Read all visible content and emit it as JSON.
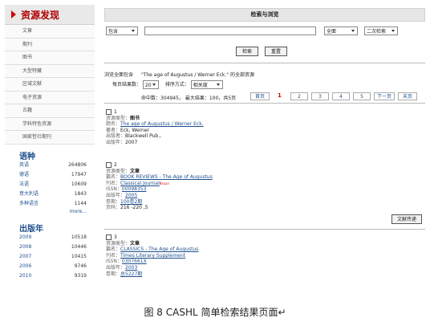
{
  "sidebar": {
    "title": "资源发现",
    "items": [
      "文章",
      "期刊",
      "图书",
      "大型特藏",
      "区域文献",
      "电子资源",
      "古籍",
      "学科特色资源",
      "国家哲社期刊"
    ],
    "languages": {
      "title": "语种",
      "rows": [
        {
          "name": "英语",
          "count": "264806"
        },
        {
          "name": "德语",
          "count": "17947"
        },
        {
          "name": "法语",
          "count": "10609"
        },
        {
          "name": "意大利语",
          "count": "1843"
        },
        {
          "name": "多种语言",
          "count": "1144"
        }
      ],
      "more": "more..."
    },
    "years": {
      "title": "出版年",
      "rows": [
        {
          "name": "2009",
          "count": "10518"
        },
        {
          "name": "2008",
          "count": "10446"
        },
        {
          "name": "2007",
          "count": "10415"
        },
        {
          "name": "2006",
          "count": "9746"
        },
        {
          "name": "2010",
          "count": "9319"
        }
      ]
    }
  },
  "search": {
    "header": "检索与浏览",
    "match_select": "包含",
    "query_value": "",
    "scope_select": "全面",
    "mode_select": "二次检索",
    "search_button": "检索",
    "reset_button": "重置"
  },
  "results": {
    "browse_prefix": "浏览全面包含",
    "browse_query": "\"The age of Augustus / Werner Eck.\"",
    "browse_suffix": "的全部资源",
    "per_page_label": "每页结果数：",
    "per_page_value": "20",
    "sort_label": "排序方式：",
    "sort_value": "相关度",
    "hits_label": "命中数：304945，",
    "max_label": "最大结果：100，共5页",
    "pager": {
      "first": "首页",
      "current": "1",
      "pages": [
        "2",
        "3",
        "4",
        "5"
      ],
      "next": "下一页",
      "last": "末页"
    },
    "records": [
      {
        "num": "1",
        "fields": [
          {
            "k": "资源类型：",
            "v": "图书",
            "link": false,
            "bold": true
          },
          {
            "k": "题名：",
            "v": "The age of Augustus / Werner Eck.",
            "link": true
          },
          {
            "k": "著者：",
            "v": "Eck, Werner",
            "link": false
          },
          {
            "k": "出版者：",
            "v": "Blackwell Pub.,",
            "link": false
          },
          {
            "k": "出版年：",
            "v": "2007",
            "link": false
          }
        ]
      },
      {
        "num": "2",
        "fields": [
          {
            "k": "资源类型：",
            "v": "文章",
            "link": false,
            "bold": true
          },
          {
            "k": "篇名：",
            "v": "BOOK REVIEWS - The Age of Augustus",
            "link": true
          },
          {
            "k": "刊名：",
            "v": "Classical Journal",
            "link": true,
            "sup": "Bscun"
          },
          {
            "k": "ISSN：",
            "v": "00098353",
            "link": true
          },
          {
            "k": "出版年：",
            "v": "2005",
            "link": true
          },
          {
            "k": "卷期：",
            "v": "100卷2期",
            "link": true
          },
          {
            "k": "页码：",
            "v": "216 -220 ,5",
            "link": false
          }
        ],
        "button": "文献传递"
      },
      {
        "num": "3",
        "fields": [
          {
            "k": "资源类型：",
            "v": "文章",
            "link": false,
            "bold": true
          },
          {
            "k": "篇名：",
            "v": "CLASSICS - The Age of Augustus",
            "link": true
          },
          {
            "k": "刊名：",
            "v": "Times Literary Supplement",
            "link": true
          },
          {
            "k": "ISSN：",
            "v": "0307661X",
            "link": true
          },
          {
            "k": "出版年：",
            "v": "2003",
            "link": true
          },
          {
            "k": "卷期：",
            "v": "总5227期",
            "link": true
          }
        ]
      }
    ]
  },
  "caption": "图 8 CASHL 简单检索结果页面↵"
}
